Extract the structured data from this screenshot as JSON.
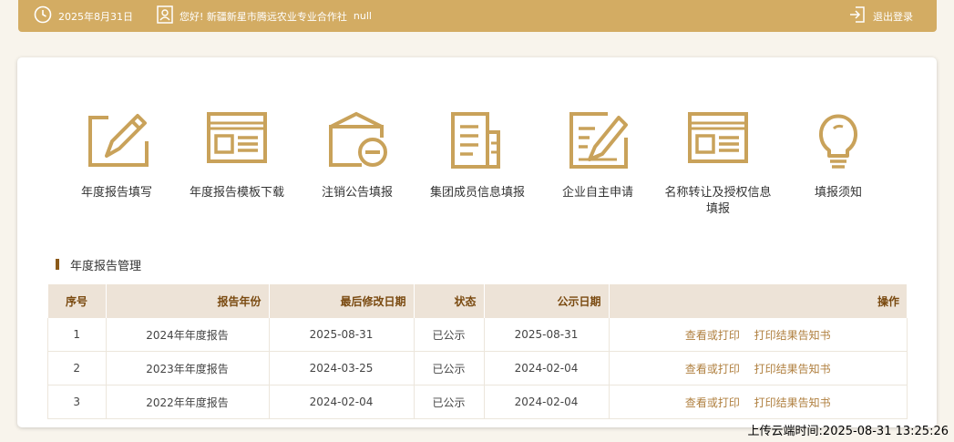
{
  "topbar": {
    "date": "2025年8月31日",
    "greeting": "您好! 新疆新星市腾远农业专业合作社",
    "user_suffix": "null",
    "logout": "退出登录"
  },
  "menu": [
    {
      "label": "年度报告填写",
      "icon": "pen-edit-icon"
    },
    {
      "label": "年度报告模板下载",
      "icon": "template-window-icon"
    },
    {
      "label": "注销公告填报",
      "icon": "cancel-folder-icon"
    },
    {
      "label": "集团成员信息填报",
      "icon": "documents-icon"
    },
    {
      "label": "企业自主申请",
      "icon": "application-edit-icon"
    },
    {
      "label": "名称转让及授权信息填报",
      "icon": "name-transfer-icon"
    },
    {
      "label": "填报须知",
      "icon": "lightbulb-icon"
    }
  ],
  "section_title": "年度报告管理",
  "table": {
    "headers": [
      "序号",
      "报告年份",
      "最后修改日期",
      "状态",
      "公示日期",
      "操作"
    ],
    "rows": [
      {
        "no": "1",
        "year": "2024年年度报告",
        "modified": "2025-08-31",
        "status": "已公示",
        "publish": "2025-08-31",
        "view": "查看或打印",
        "print": "打印结果告知书"
      },
      {
        "no": "2",
        "year": "2023年年度报告",
        "modified": "2024-03-25",
        "status": "已公示",
        "publish": "2024-02-04",
        "view": "查看或打印",
        "print": "打印结果告知书"
      },
      {
        "no": "3",
        "year": "2022年年度报告",
        "modified": "2024-02-04",
        "status": "已公示",
        "publish": "2024-02-04",
        "view": "查看或打印",
        "print": "打印结果告知书"
      }
    ]
  },
  "upload_time": "上传云端时间:2025-08-31 13:25:26",
  "colors": {
    "gold": "#d3ac63",
    "icon": "#c9a25a",
    "header_bg": "#ede3d7",
    "header_text": "#7a4a10"
  }
}
